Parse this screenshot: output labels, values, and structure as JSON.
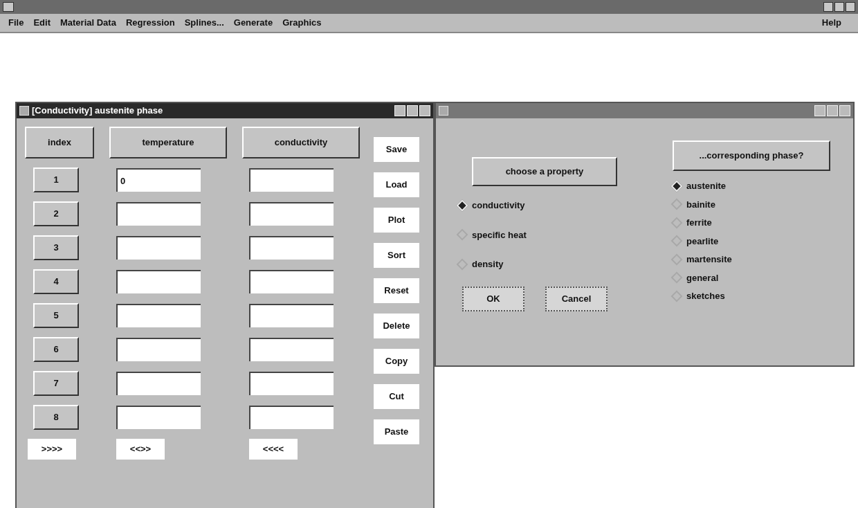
{
  "menu_bar": {
    "items": [
      "File",
      "Edit",
      "Material Data",
      "Regression",
      "Splines...",
      "Generate",
      "Graphics"
    ],
    "help": "Help"
  },
  "table_window": {
    "title": "[Conductivity] austenite phase",
    "columns": [
      "index",
      "temperature",
      "conductivity"
    ],
    "rows": [
      {
        "index": "1",
        "temperature": "0",
        "conductivity": ""
      },
      {
        "index": "2"
      },
      {
        "index": "3"
      },
      {
        "index": "4"
      },
      {
        "index": "5"
      },
      {
        "index": "6"
      },
      {
        "index": "7"
      },
      {
        "index": "8"
      }
    ],
    "nav_buttons": [
      ">>>>",
      "<<>>",
      "<<<<"
    ],
    "actions": [
      "Save",
      "Load",
      "Plot",
      "Sort",
      "Reset",
      "Delete",
      "Copy",
      "Cut",
      "Paste"
    ]
  },
  "property_dialog": {
    "property_header": "choose a property",
    "properties": [
      {
        "label": "conductivity",
        "selected": true
      },
      {
        "label": "specific heat",
        "selected": false
      },
      {
        "label": "density",
        "selected": false
      }
    ],
    "buttons": [
      "OK",
      "Cancel"
    ],
    "phase_header": "...corresponding phase?",
    "phases": [
      {
        "label": "austenite",
        "selected": true
      },
      {
        "label": "bainite",
        "selected": false
      },
      {
        "label": "ferrite",
        "selected": false
      },
      {
        "label": "pearlite",
        "selected": false
      },
      {
        "label": "martensite",
        "selected": false
      },
      {
        "label": "general",
        "selected": false
      },
      {
        "label": "sketches",
        "selected": false
      }
    ]
  }
}
